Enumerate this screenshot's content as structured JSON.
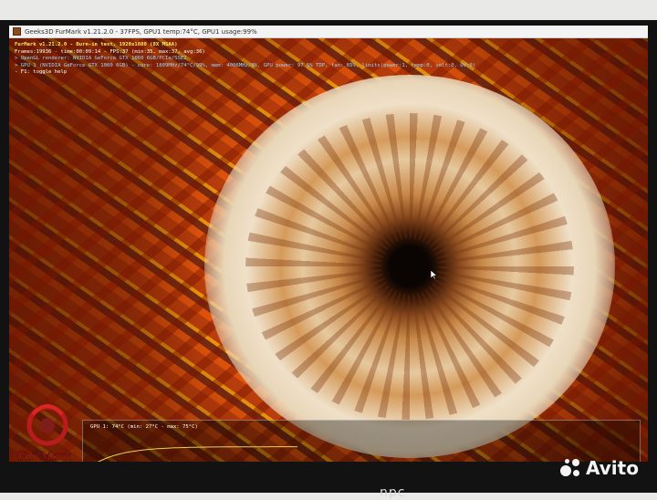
{
  "window": {
    "title": "Geeks3D FurMark v1.21.2.0 - 37FPS, GPU1 temp:74°C, GPU1 usage:99%"
  },
  "osd": {
    "line1": "FurMark v1.21.2.0 - Burn-in test, 1920x1080 (8X MSAA)",
    "line2": "Frames:19936 - time:00:09:14 - FPS:37 (min:35, max:37, avg:36)",
    "line3": "> OpenGL renderer: NVIDIA GeForce GTX 1060 6GB/PCIe/SSE2",
    "line4": "> GPU 1 (NVIDIA GeForce GTX 1060 6GB) - core: 1809MHz/74°C/99%, mem: 4006MHz/8%, GPU power: 97.6% TDP, fan: 65%, limits(power:1, temp:0, volt:0, OV:0)",
    "line5": "- F1: toggle help"
  },
  "graph": {
    "label": "GPU 1: 74°C (min: 27°C - max: 75°C)",
    "min_temp": 27,
    "max_temp": 75,
    "current_temp": 74,
    "line_color": "#e8d25a"
  },
  "logo": {
    "text": "FurMark"
  },
  "monitor": {
    "brand": "npc"
  },
  "watermark": {
    "text": "Avito"
  }
}
